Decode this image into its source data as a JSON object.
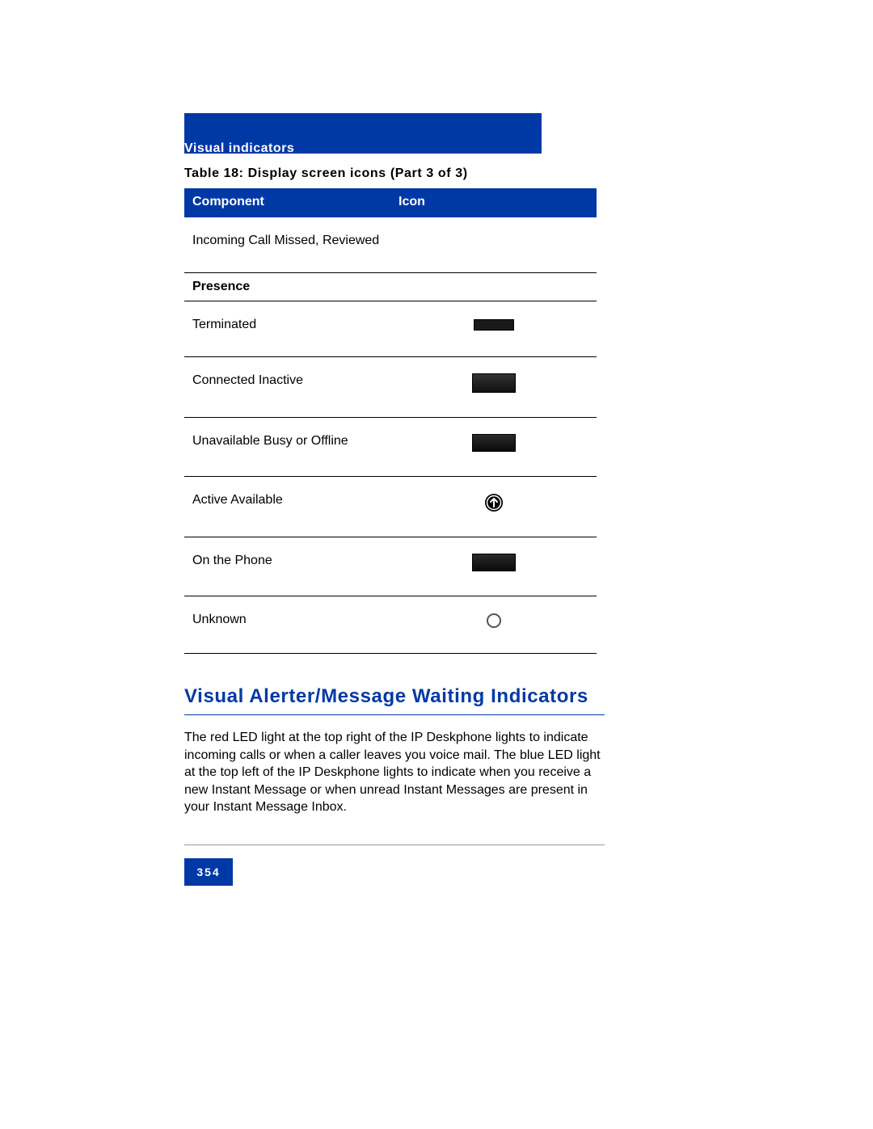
{
  "header": {
    "section_label": "Visual indicators"
  },
  "table": {
    "caption": "Table 18: Display screen icons (Part 3 of 3)",
    "columns": {
      "component": "Component",
      "icon": "Icon"
    },
    "rows": [
      {
        "component": "Incoming Call Missed, Reviewed",
        "icon_name": ""
      },
      {
        "section": "Presence"
      },
      {
        "component": "Terminated",
        "icon_name": "terminated-icon"
      },
      {
        "component": "Connected Inactive",
        "icon_name": "connected-inactive-icon"
      },
      {
        "component": "Unavailable Busy or Offline",
        "icon_name": "unavailable-icon"
      },
      {
        "component": "Active Available",
        "icon_name": "active-available-icon"
      },
      {
        "component": "On the Phone",
        "icon_name": "on-the-phone-icon"
      },
      {
        "component": "Unknown",
        "icon_name": "unknown-icon"
      }
    ]
  },
  "section": {
    "heading": "Visual Alerter/Message Waiting Indicators",
    "body": "The red LED light at the top right of the IP Deskphone lights to indicate incoming calls or when a caller leaves you voice mail. The blue LED light at the top left of the IP Deskphone lights to indicate when you receive a new Instant Message or when unread Instant Messages are present in your Instant Message Inbox."
  },
  "footer": {
    "page_number": "354"
  },
  "colors": {
    "brand_blue": "#0039a6"
  }
}
